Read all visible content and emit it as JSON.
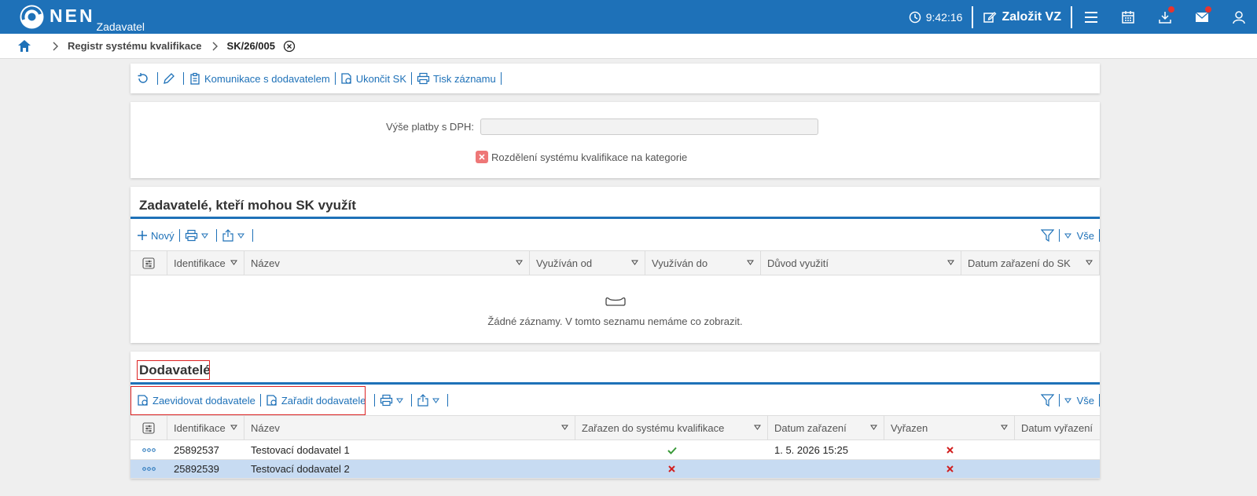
{
  "topbar": {
    "brand": "NEN",
    "subtitle": "Zadavatel",
    "time": "9:42:16",
    "new_label": "Založit VZ",
    "icons": [
      "menu-icon",
      "calendar-icon",
      "download-icon",
      "mail-icon",
      "user-icon"
    ]
  },
  "breadcrumb": {
    "items": [
      "Registr systému kvalifikace",
      "SK/26/005"
    ]
  },
  "main_toolbar": {
    "communication": "Komunikace s dodavatelem",
    "end_sk": "Ukončit SK",
    "print": "Tisk záznamu"
  },
  "form": {
    "payment_label": "Výše platby s DPH:",
    "payment_value": "",
    "categories_label": "Rozdělení systému kvalifikace na kategorie",
    "categories_checked": false
  },
  "contracting_section": {
    "title": "Zadavatelé, kteří mohou SK využít",
    "new_label": "Nový",
    "filter_all": "Vše",
    "columns": [
      "Identifikace",
      "Název",
      "Využíván od",
      "Využíván do",
      "Důvod využití",
      "Datum zařazení do SK"
    ],
    "empty_text": "Žádné záznamy. V tomto seznamu nemáme co zobrazit."
  },
  "suppliers_section": {
    "title": "Dodavatelé",
    "register_label": "Zaevidovat dodavatele",
    "assign_label": "Zařadit dodavatele",
    "filter_all": "Vše",
    "columns": [
      "Identifikace",
      "Název",
      "Zařazen do systému kvalifikace",
      "Datum zařazení",
      "Vyřazen",
      "Datum vyřazení"
    ],
    "rows": [
      {
        "id": "25892537",
        "name": "Testovací dodavatel 1",
        "included": true,
        "date": "1. 5. 2026 15:25",
        "excluded": false,
        "excluded_date": "",
        "selected": false
      },
      {
        "id": "25892539",
        "name": "Testovací dodavatel 2",
        "included": false,
        "date": "",
        "excluded": false,
        "excluded_date": "",
        "selected": true
      }
    ]
  },
  "colors": {
    "brand": "#1e71b8",
    "ok": "#3a9a3a",
    "no": "#d22020",
    "selected_row": "#c7dbf2"
  }
}
